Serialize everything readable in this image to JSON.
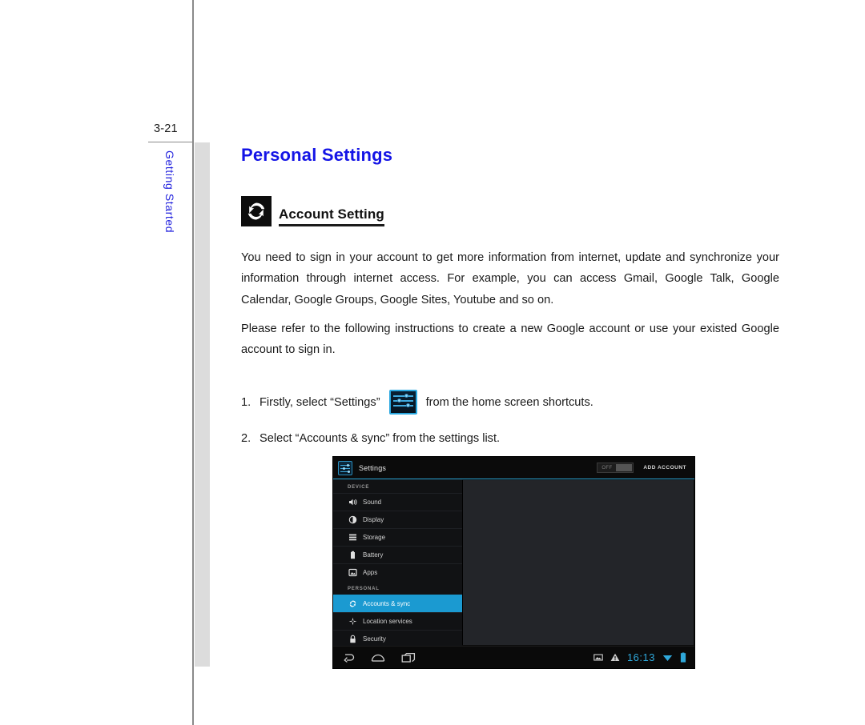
{
  "page": {
    "number": "3-21",
    "side_tab": "Getting Started",
    "title": "Personal Settings",
    "title_color": "#1414e6"
  },
  "section": {
    "icon": "sync-icon",
    "heading": "Account Setting"
  },
  "paragraphs": [
    "You need to sign in your account to get more information from internet, update and synchronize your information through internet access. For example, you can access Gmail, Google Talk, Google Calendar, Google Groups, Google Sites, Youtube and so on.",
    "Please refer to the following instructions to create a new Google account or use your existed Google account to sign in."
  ],
  "steps": [
    {
      "number": "1.",
      "text_before": "Firstly, select “Settings”",
      "inline_icon": "settings-sliders-icon",
      "text_after": "from the home screen shortcuts."
    },
    {
      "number": "2.",
      "text_before": "Select “Accounts & sync” from the settings list.",
      "inline_icon": "",
      "text_after": ""
    }
  ],
  "tablet": {
    "actionbar": {
      "app_icon": "settings-sliders-icon",
      "title": "Settings",
      "toggle_label": "OFF",
      "add_account_label": "ADD ACCOUNT"
    },
    "accent_color": "#29a3d4",
    "sections": [
      {
        "label": "DEVICE",
        "items": [
          {
            "label": "Sound",
            "icon": "speaker-icon",
            "selected": false
          },
          {
            "label": "Display",
            "icon": "brightness-icon",
            "selected": false
          },
          {
            "label": "Storage",
            "icon": "storage-icon",
            "selected": false
          },
          {
            "label": "Battery",
            "icon": "battery-icon",
            "selected": false
          },
          {
            "label": "Apps",
            "icon": "apps-icon",
            "selected": false
          }
        ]
      },
      {
        "label": "PERSONAL",
        "items": [
          {
            "label": "Accounts & sync",
            "icon": "sync-icon",
            "selected": true
          },
          {
            "label": "Location services",
            "icon": "location-icon",
            "selected": false
          },
          {
            "label": "Security",
            "icon": "lock-icon",
            "selected": false
          }
        ]
      }
    ],
    "navbar": {
      "buttons": [
        {
          "name": "back-icon"
        },
        {
          "name": "home-icon"
        },
        {
          "name": "recents-icon"
        }
      ],
      "status": {
        "screenshot_icon": "screenshot-icon",
        "warning_icon": "warning-icon",
        "clock": "16:13",
        "wifi_icon": "wifi-icon",
        "battery_icon": "battery-status-icon"
      }
    }
  }
}
